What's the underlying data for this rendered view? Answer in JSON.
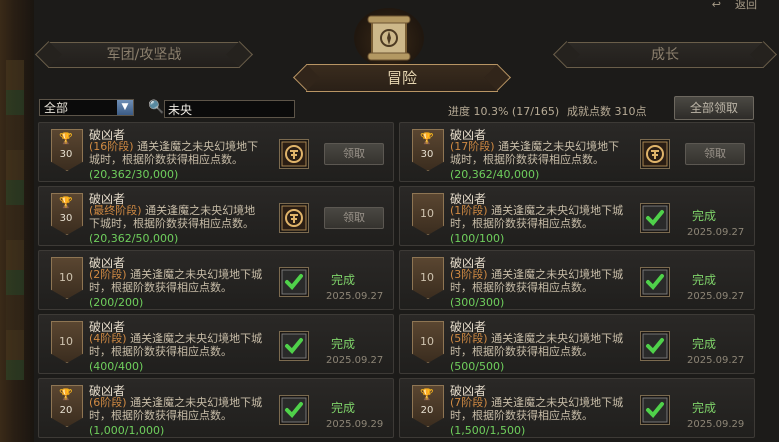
{
  "header": {
    "back_label": "返回",
    "tabs": {
      "legion": "军团/攻坚战",
      "adventure": "冒险",
      "growth": "成长"
    }
  },
  "filter": {
    "category_selected": "全部",
    "search_value": "未央",
    "progress_text": "进度 10.3% (17/165)",
    "points_text": "成就点数 310点",
    "claim_all_label": "全部领取"
  },
  "cards": [
    {
      "title": "破凶者",
      "stage": "(16阶段)",
      "desc": "通关逢魔之未央幻境地下城时，根据阶数获得相应点数。",
      "progress": "(20,362/30,000)",
      "points": "30",
      "trophy": true,
      "state": "claim",
      "button": "领取"
    },
    {
      "title": "破凶者",
      "stage": "(17阶段)",
      "desc": "通关逢魔之未央幻境地下城时，根据阶数获得相应点数。",
      "progress": "(20,362/40,000)",
      "points": "30",
      "trophy": true,
      "state": "claim",
      "button": "领取"
    },
    {
      "title": "破凶者",
      "stage": "(最终阶段)",
      "desc": "通关逢魔之未央幻境地下城时，根据阶数获得相应点数。",
      "progress": "(20,362/50,000)",
      "points": "30",
      "trophy": true,
      "state": "claim",
      "button": "领取"
    },
    {
      "title": "破凶者",
      "stage": "(1阶段)",
      "desc": "通关逢魔之未央幻境地下城时，根据阶数获得相应点数。",
      "progress": "(100/100)",
      "points": "10",
      "trophy": false,
      "state": "done",
      "done": "完成",
      "date": "2025.09.27"
    },
    {
      "title": "破凶者",
      "stage": "(2阶段)",
      "desc": "通关逢魔之未央幻境地下城时，根据阶数获得相应点数。",
      "progress": "(200/200)",
      "points": "10",
      "trophy": false,
      "state": "done",
      "done": "完成",
      "date": "2025.09.27"
    },
    {
      "title": "破凶者",
      "stage": "(3阶段)",
      "desc": "通关逢魔之未央幻境地下城时，根据阶数获得相应点数。",
      "progress": "(300/300)",
      "points": "10",
      "trophy": false,
      "state": "done",
      "done": "完成",
      "date": "2025.09.27"
    },
    {
      "title": "破凶者",
      "stage": "(4阶段)",
      "desc": "通关逢魔之未央幻境地下城时，根据阶数获得相应点数。",
      "progress": "(400/400)",
      "points": "10",
      "trophy": false,
      "state": "done",
      "done": "完成",
      "date": "2025.09.27"
    },
    {
      "title": "破凶者",
      "stage": "(5阶段)",
      "desc": "通关逢魔之未央幻境地下城时，根据阶数获得相应点数。",
      "progress": "(500/500)",
      "points": "10",
      "trophy": false,
      "state": "done",
      "done": "完成",
      "date": "2025.09.27"
    },
    {
      "title": "破凶者",
      "stage": "(6阶段)",
      "desc": "通关逢魔之未央幻境地下城时，根据阶数获得相应点数。",
      "progress": "(1,000/1,000)",
      "points": "20",
      "trophy": true,
      "state": "done",
      "done": "完成",
      "date": "2025.09.29"
    },
    {
      "title": "破凶者",
      "stage": "(7阶段)",
      "desc": "通关逢魔之未央幻境地下城时，根据阶数获得相应点数。",
      "progress": "(1,500/1,500)",
      "points": "20",
      "trophy": true,
      "state": "done",
      "done": "完成",
      "date": "2025.09.29"
    }
  ]
}
